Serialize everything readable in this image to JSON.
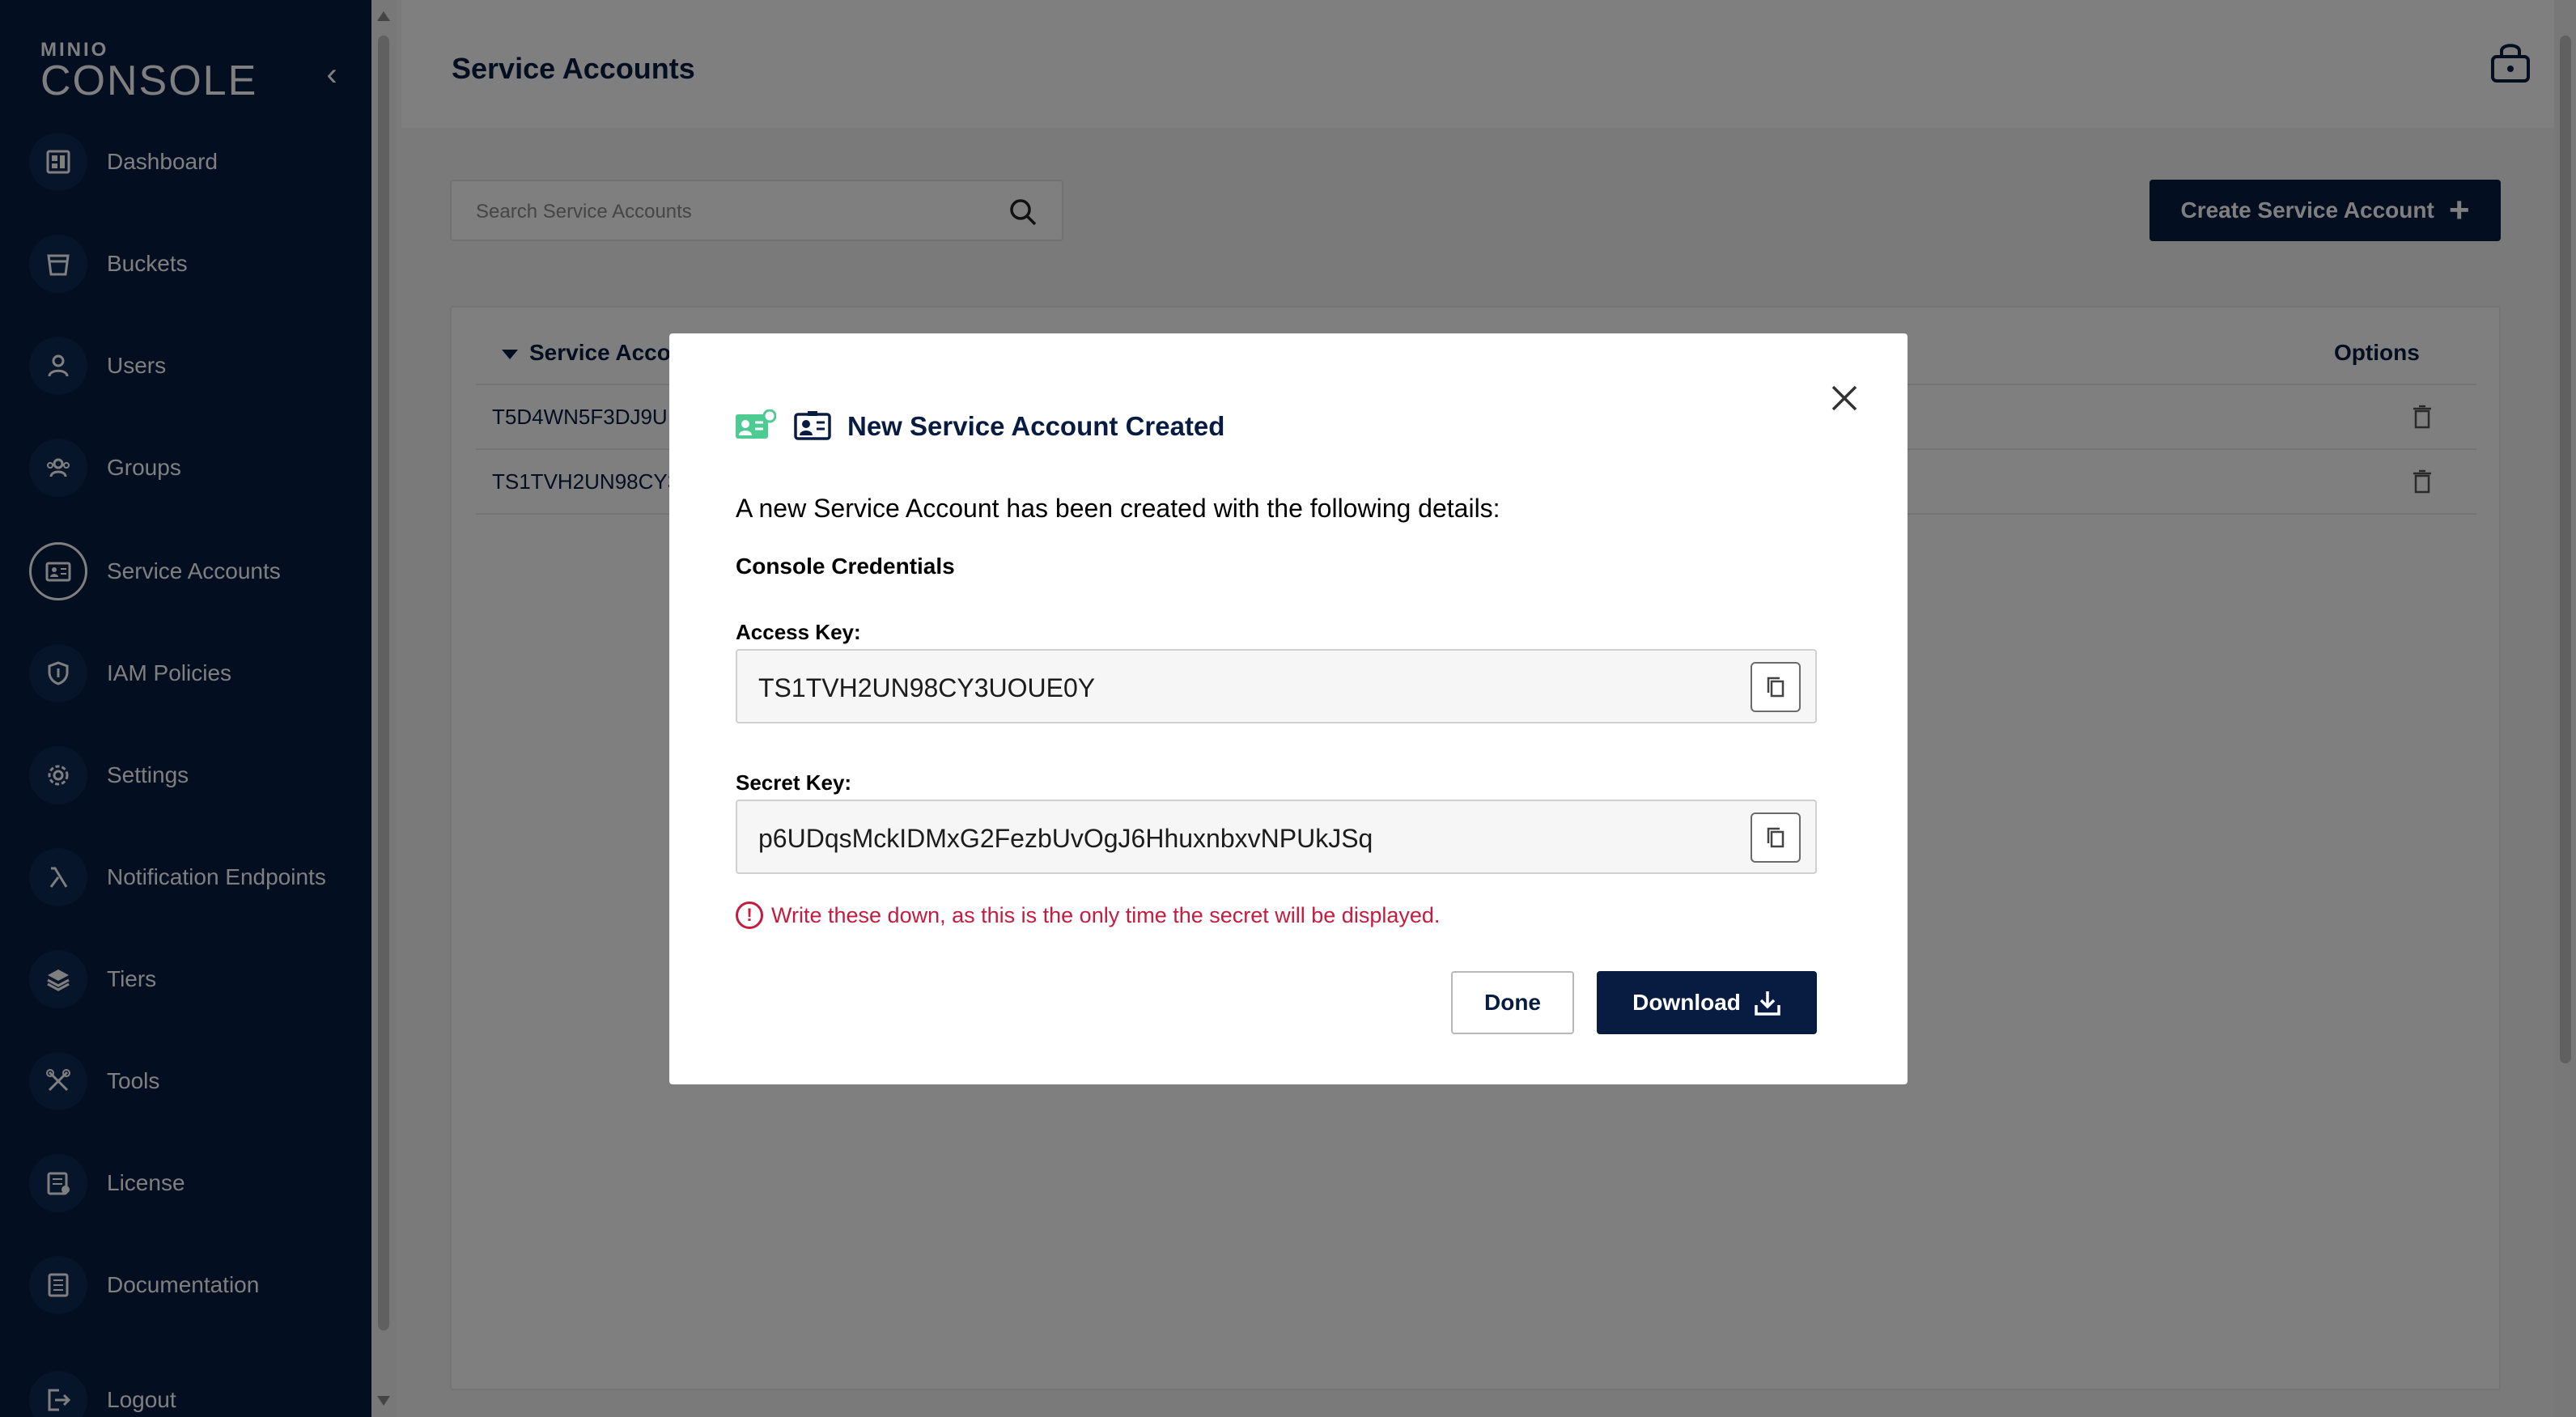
{
  "sidebar": {
    "logo_top": "MINIO",
    "logo_bottom": "CONSOLE",
    "items": [
      {
        "label": "Dashboard",
        "icon": "dashboard-icon"
      },
      {
        "label": "Buckets",
        "icon": "bucket-icon"
      },
      {
        "label": "Users",
        "icon": "user-icon"
      },
      {
        "label": "Groups",
        "icon": "groups-icon"
      },
      {
        "label": "Service Accounts",
        "icon": "service-account-icon",
        "active": true
      },
      {
        "label": "IAM Policies",
        "icon": "shield-icon"
      },
      {
        "label": "Settings",
        "icon": "gear-icon"
      },
      {
        "label": "Notification Endpoints",
        "icon": "lambda-icon"
      },
      {
        "label": "Tiers",
        "icon": "layers-icon"
      },
      {
        "label": "Tools",
        "icon": "tools-icon"
      },
      {
        "label": "License",
        "icon": "license-icon"
      },
      {
        "label": "Documentation",
        "icon": "document-icon"
      },
      {
        "label": "Logout",
        "icon": "logout-icon"
      }
    ]
  },
  "header": {
    "title": "Service Accounts"
  },
  "toolbar": {
    "search_placeholder": "Search Service Accounts",
    "create_label": "Create Service Account"
  },
  "table": {
    "column_name": "Service Accou",
    "column_options": "Options",
    "rows": [
      {
        "name": "T5D4WN5F3DJ9U"
      },
      {
        "name": "TS1TVH2UN98CY3"
      }
    ]
  },
  "modal": {
    "title": "New Service Account Created",
    "intro": "A new Service Account has been created with the following details:",
    "section": "Console Credentials",
    "access_key_label": "Access Key:",
    "access_key_value": "TS1TVH2UN98CY3UOUE0Y",
    "secret_key_label": "Secret Key:",
    "secret_key_value": "p6UDqsMckIDMxG2FezbUvOgJ6HhuxnbxvNPUkJSq",
    "warning": "Write these down, as this is the only time the secret will be displayed.",
    "warning_icon": "!",
    "done_label": "Done",
    "download_label": "Download"
  },
  "colors": {
    "brand": "#081c42",
    "danger": "#c51b3f",
    "success_icon": "#4ccb92"
  }
}
